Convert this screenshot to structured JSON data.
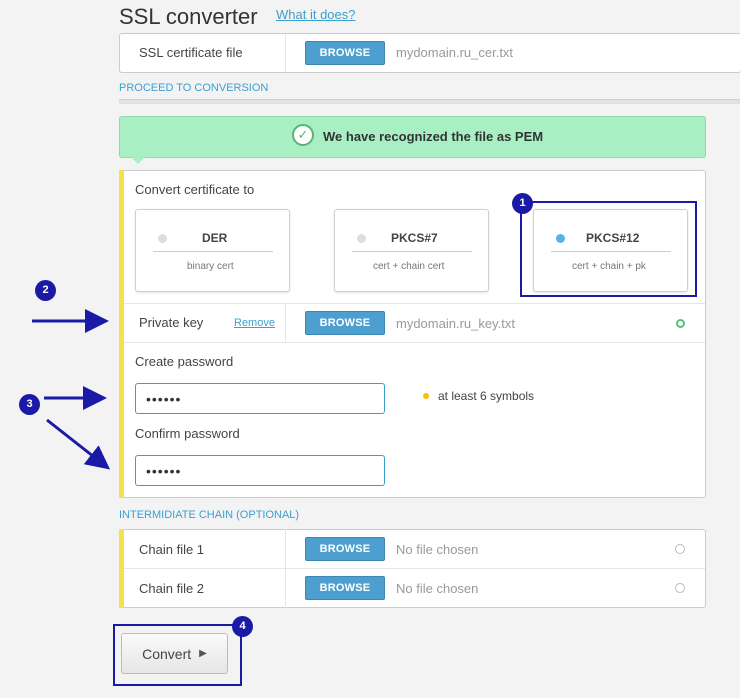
{
  "header": {
    "title": "SSL converter",
    "what_link": "What it does?"
  },
  "certificate": {
    "label": "SSL certificate file",
    "browse_label": "BROWSE",
    "filename": "mydomain.ru_cer.txt"
  },
  "proceed_label": "PROCEED TO CONVERSION",
  "recognized_message": "We have recognized the file as PEM",
  "convert_to": {
    "label": "Convert certificate to",
    "options": [
      {
        "name": "DER",
        "sub": "binary cert",
        "selected": false
      },
      {
        "name": "PKCS#7",
        "sub": "cert + chain cert",
        "selected": false
      },
      {
        "name": "PKCS#12",
        "sub": "cert + chain + pk",
        "selected": true
      }
    ]
  },
  "private_key": {
    "label": "Private key",
    "remove_label": "Remove",
    "browse_label": "BROWSE",
    "filename": "mydomain.ru_key.txt"
  },
  "password": {
    "create_label": "Create password",
    "create_value": "••••••",
    "hint": "at least 6 symbols",
    "confirm_label": "Confirm password",
    "confirm_value": "••••••"
  },
  "chain": {
    "section_label": "INTERMIDIATE CHAIN (OPTIONAL)",
    "files": [
      {
        "label": "Chain file 1",
        "browse_label": "BROWSE",
        "filename": "No file chosen"
      },
      {
        "label": "Chain file 2",
        "browse_label": "BROWSE",
        "filename": "No file chosen"
      }
    ]
  },
  "convert_button": {
    "label": "Convert",
    "arrow": "▶"
  },
  "annotations": {
    "badges": [
      "1",
      "2",
      "3",
      "4"
    ],
    "color": "#1a1aa6"
  },
  "colors": {
    "accent": "#4d9fcf",
    "success_bg": "#a8f0c3",
    "highlight_bar": "#f7e14a"
  }
}
